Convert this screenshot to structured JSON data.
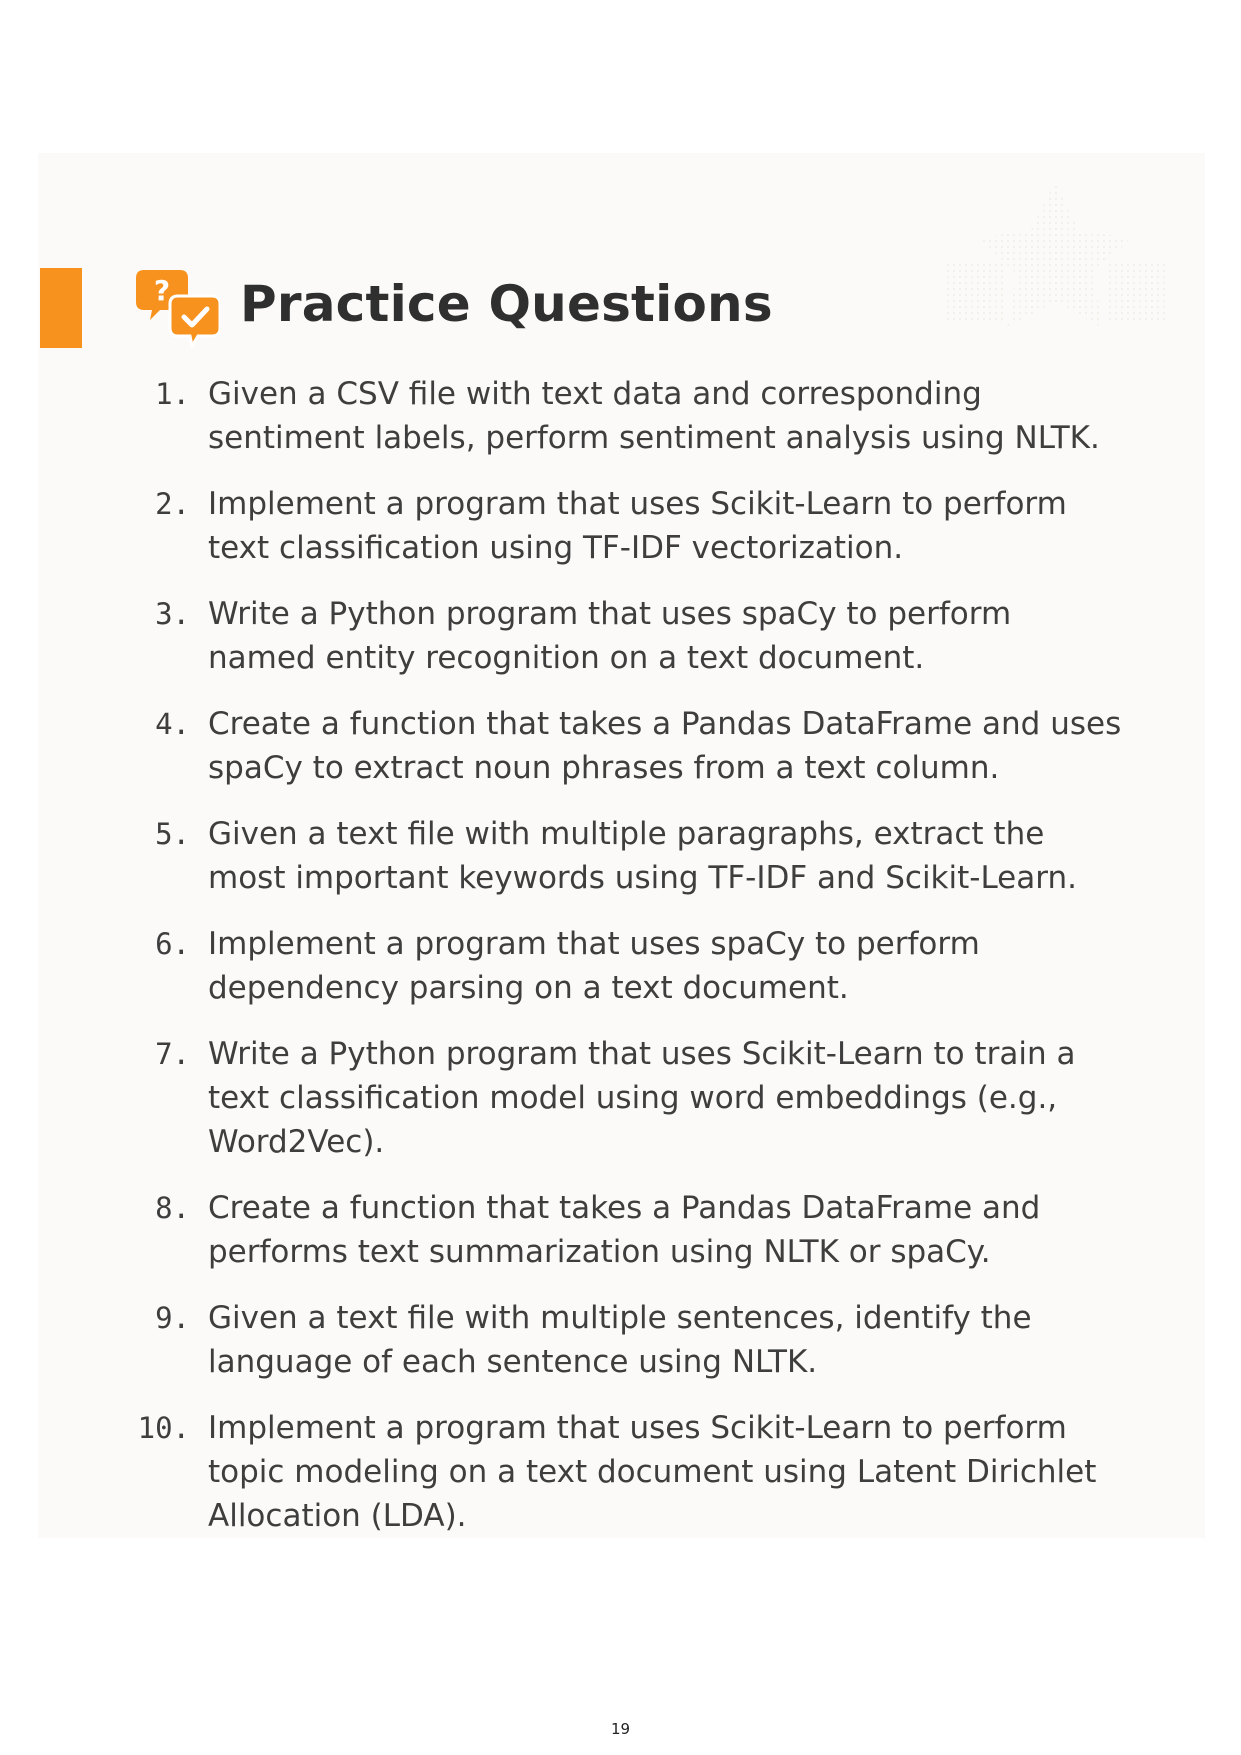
{
  "page": {
    "title": "Practice Questions",
    "icon": "question-answer-bubbles-icon",
    "accent_color": "#f7921e",
    "page_number": "19"
  },
  "questions": [
    {
      "number": "1.",
      "text": "Given a CSV file with text data and corresponding sentiment labels, perform sentiment analysis using NLTK."
    },
    {
      "number": "2.",
      "text": "Implement a program that uses Scikit-Learn to perform text classification using TF-IDF vectorization."
    },
    {
      "number": "3.",
      "text": "Write a Python program that uses spaCy to perform named entity recognition on a text document."
    },
    {
      "number": "4.",
      "text": "Create a function that takes a Pandas DataFrame and uses spaCy to extract noun phrases from a text column."
    },
    {
      "number": "5.",
      "text": "Given a text file with multiple paragraphs, extract the most important keywords using TF-IDF and Scikit-Learn."
    },
    {
      "number": "6.",
      "text": "Implement a program that uses spaCy to perform dependency parsing on a text document."
    },
    {
      "number": "7.",
      "text": "Write a Python program that uses Scikit-Learn to train a text classification model using word embeddings (e.g., Word2Vec)."
    },
    {
      "number": "8.",
      "text": "Create a function that takes a Pandas DataFrame and performs text summarization using NLTK or spaCy."
    },
    {
      "number": "9.",
      "text": "Given a text file with multiple sentences, identify the language of each sentence using NLTK."
    },
    {
      "number": "10.",
      "text": "Implement a program that uses Scikit-Learn to perform topic modeling on a text document using Latent Dirichlet Allocation (LDA)."
    }
  ]
}
